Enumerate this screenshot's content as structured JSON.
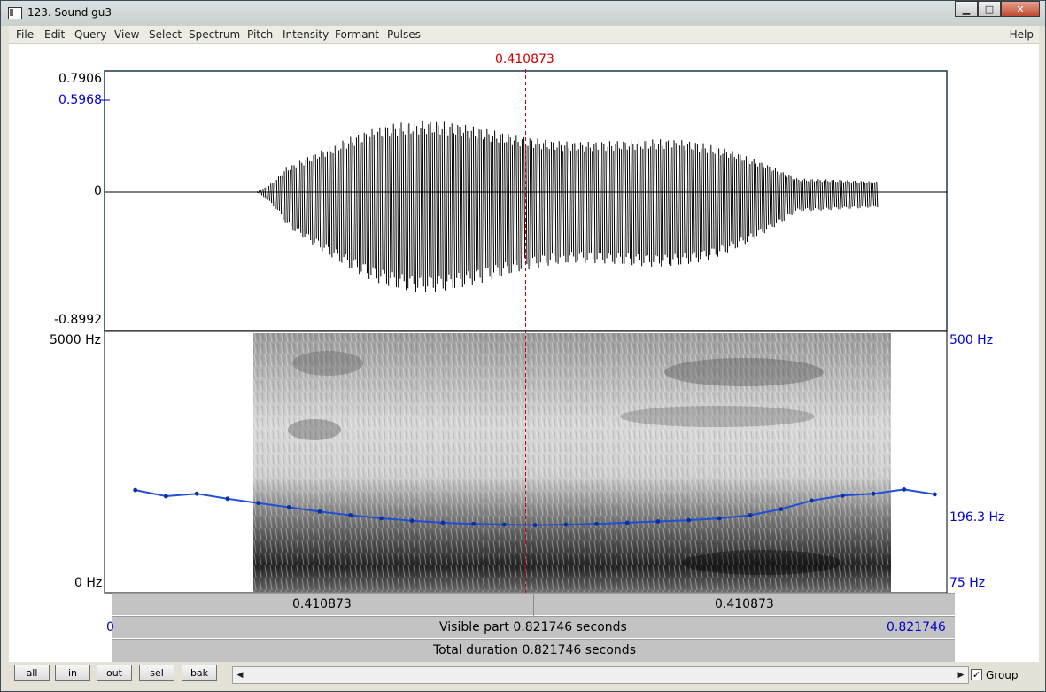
{
  "window": {
    "title": "123. Sound gu3",
    "min": "▁",
    "max": "□",
    "close": "✕"
  },
  "menu": [
    "File",
    "Edit",
    "Query",
    "View",
    "Select",
    "Spectrum",
    "Pitch",
    "Intensity",
    "Formant",
    "Pulses"
  ],
  "help": "Help",
  "cursor": {
    "time_label": "0.410873",
    "time": 0.410873
  },
  "waveform": {
    "max_label": "0.7906",
    "sel_label": "0.5968",
    "zero_label": "0",
    "min_label": "-0.8992",
    "max": 0.7906,
    "min": -0.8992
  },
  "spectrogram": {
    "top_label": "5000 Hz",
    "bottom_label": "0 Hz",
    "pitch_top_label": "500 Hz",
    "pitch_mid_label": "196.3 Hz",
    "pitch_bottom_label": "75 Hz"
  },
  "pitch_data": {
    "type": "line",
    "x": [
      0.03,
      0.06,
      0.09,
      0.12,
      0.15,
      0.18,
      0.21,
      0.24,
      0.27,
      0.3,
      0.33,
      0.36,
      0.39,
      0.42,
      0.45,
      0.48,
      0.51,
      0.54,
      0.57,
      0.6,
      0.63,
      0.66,
      0.69,
      0.72,
      0.75,
      0.78,
      0.81
    ],
    "values": [
      242,
      232,
      236,
      228,
      221,
      214,
      207,
      201,
      196,
      192,
      189,
      187,
      186,
      185,
      186,
      187,
      189,
      191,
      193,
      196,
      201,
      211,
      225,
      233,
      236,
      243,
      235
    ],
    "ylim": [
      75,
      500
    ],
    "xlim": [
      0,
      0.821746
    ]
  },
  "bars": {
    "left_time": "0.410873",
    "right_time": "0.410873",
    "visible_start": "0",
    "visible_text": "Visible part 0.821746 seconds",
    "visible_end": "0.821746",
    "total_text": "Total duration 0.821746 seconds"
  },
  "buttons": [
    "all",
    "in",
    "out",
    "sel",
    "bak"
  ],
  "group_label": "Group",
  "group_checked": "✓",
  "scroll_left": "◀",
  "scroll_right": "▶",
  "colors": {
    "pitch": "#1f4fd6",
    "cursor": "#cc0000",
    "label_blue": "#0000cc"
  }
}
